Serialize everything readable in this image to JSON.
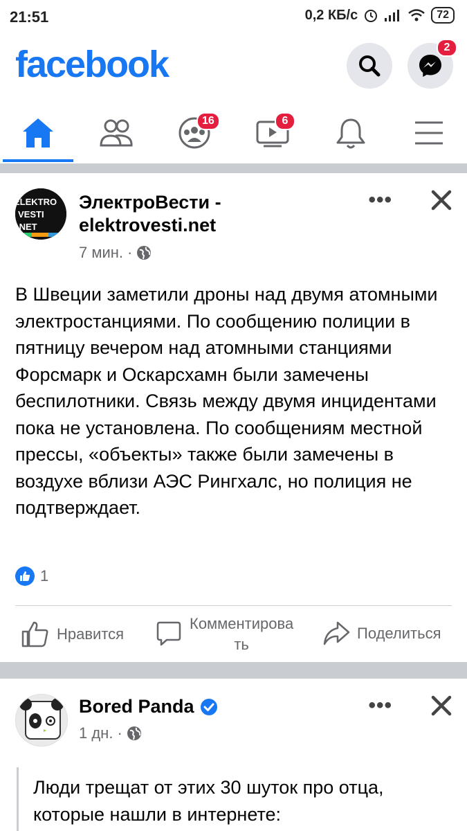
{
  "status_bar": {
    "time": "21:51",
    "speed": "0,2 КБ/с",
    "battery": "72"
  },
  "header": {
    "logo": "facebook",
    "brand_color": "#1877f2",
    "messenger_badge": "2"
  },
  "tabs": [
    {
      "name": "home",
      "icon": "home-icon",
      "badge": ""
    },
    {
      "name": "friends",
      "icon": "friends-icon",
      "badge": ""
    },
    {
      "name": "groups",
      "icon": "groups-icon",
      "badge": "16"
    },
    {
      "name": "watch",
      "icon": "video-icon",
      "badge": "6"
    },
    {
      "name": "notifications",
      "icon": "bell-icon",
      "badge": ""
    },
    {
      "name": "menu",
      "icon": "menu-icon",
      "badge": ""
    }
  ],
  "posts": [
    {
      "author_line1": "ЭлектроВести -",
      "author_line2": "elektrovesti.net",
      "time": "7 мин.",
      "avatar_text": [
        "ELEKTRO",
        "VESTI",
        ".NET"
      ],
      "text": "В Швеции заметили дроны над двумя атомными электростанциями. По сообщению полиции в пятницу вечером над атомными станциями Форсмарк и Оскарсхамн были замечены беспилотники. Связь между двумя инцидентами пока не установлена. По сообщениям местной прессы, «объекты» также были замечены в воздухе вблизи АЭС Рингхалс, но полиция не подтверждает.",
      "likes": "1",
      "actions": {
        "like": "Нравится",
        "comment_line1": "Комментирова",
        "comment_line2": "ть",
        "share": "Поделиться"
      }
    },
    {
      "author": "Bored Panda",
      "verified": true,
      "time": "1 дн.",
      "text_line1": "Люди трещат от этих 30 шуток про отца,",
      "text_line2": "которые нашли в интернете:"
    }
  ]
}
